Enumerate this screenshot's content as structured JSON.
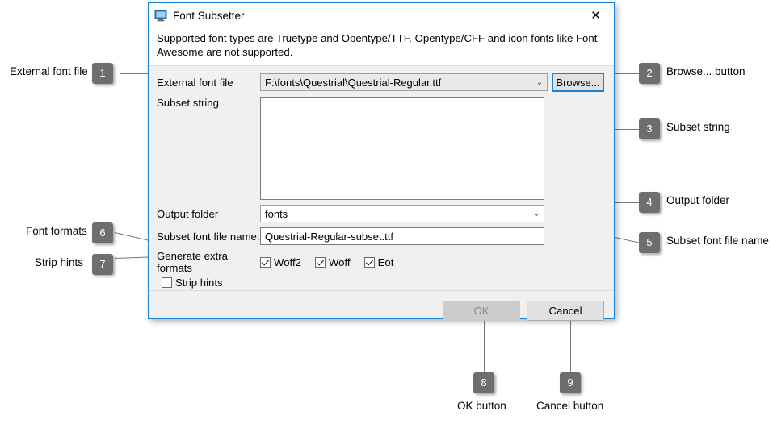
{
  "dialog": {
    "title": "Font Subsetter",
    "title_icon": "monitor-icon",
    "close_icon": "✕",
    "info_text": "Supported font types are Truetype and Opentype/TTF. Opentype/CFF and icon fonts like Font Awesome are not supported.",
    "fields": {
      "external_font_file": {
        "label": "External font file",
        "value": "F:\\fonts\\Questrial\\Questrial-Regular.ttf",
        "chevron": "⌄"
      },
      "browse_button": "Browse...",
      "subset_string": {
        "label": "Subset string",
        "value": ""
      },
      "output_folder": {
        "label": "Output folder",
        "value": "fonts",
        "chevron": "⌄"
      },
      "subset_font_file_name": {
        "label": "Subset font file name:",
        "value": "Questrial-Regular-subset.ttf"
      },
      "generate_extra_formats": {
        "label": "Generate extra formats",
        "options": [
          {
            "label": "Woff2",
            "checked": true
          },
          {
            "label": "Woff",
            "checked": true
          },
          {
            "label": "Eot",
            "checked": true
          }
        ]
      },
      "strip_hints": {
        "label": "Strip hints",
        "checked": false
      }
    },
    "buttons": {
      "ok": {
        "label": "OK",
        "enabled": false
      },
      "cancel": {
        "label": "Cancel",
        "enabled": true
      }
    }
  },
  "annotations": [
    {
      "number": "1",
      "label": "External font file"
    },
    {
      "number": "2",
      "label": "Browse... button"
    },
    {
      "number": "3",
      "label": "Subset string"
    },
    {
      "number": "4",
      "label": "Output folder"
    },
    {
      "number": "5",
      "label": "Subset font file name"
    },
    {
      "number": "6",
      "label": "Font formats"
    },
    {
      "number": "7",
      "label": "Strip hints"
    },
    {
      "number": "8",
      "label": "OK button"
    },
    {
      "number": "9",
      "label": "Cancel button"
    }
  ],
  "colors": {
    "dialog_border": "#1883d7",
    "callout_badge": "#6e6e6e",
    "leader_line": "#777777",
    "dialog_bg": "#f0f0f0"
  }
}
